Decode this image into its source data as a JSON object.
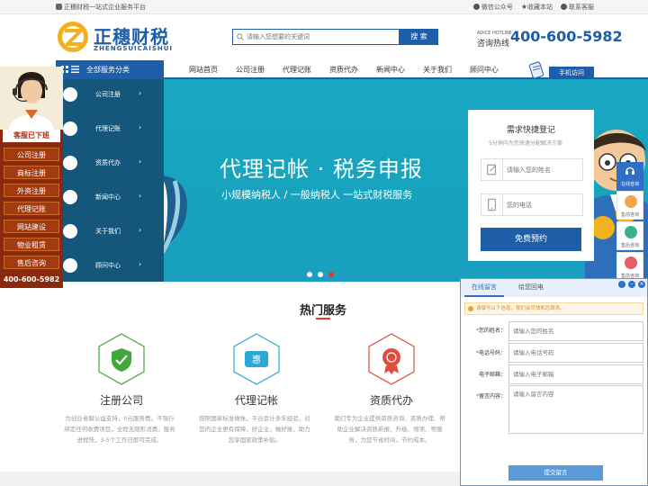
{
  "topbar": {
    "slogan": "正穗财税一站式企业服务平台",
    "links": [
      "微信公众号",
      "收藏本站",
      "联系客服"
    ]
  },
  "header": {
    "logo_cn": "正穗财税",
    "logo_en": "ZHENGSUICAISHUI",
    "search_placeholder": "请输入您想要的关键词",
    "search_button": "搜 索",
    "hotline_en": "ADICE HOTLINE",
    "hotline_cn": "咨询热线",
    "hotline_number": "400-600-5982"
  },
  "nav": {
    "category_label": "全部服务分类",
    "items": [
      "网站首页",
      "公司注册",
      "代理记账",
      "资质代办",
      "新闻中心",
      "关于我们",
      "顾问中心"
    ],
    "mobile_label": "手机访问"
  },
  "category_menu": {
    "items": [
      {
        "label": "公司注册",
        "arrow": "›"
      },
      {
        "label": "代理记账",
        "arrow": "›"
      },
      {
        "label": "资质代办",
        "arrow": "›"
      },
      {
        "label": "新闻中心",
        "arrow": "›"
      },
      {
        "label": "关于我们",
        "arrow": "›"
      },
      {
        "label": "顾问中心",
        "arrow": "›"
      }
    ]
  },
  "banner": {
    "title": "代理记帐 · 税务申报",
    "subtitle": "小规模纳税人 / 一般纳税人   一站式财税服务",
    "slide_count": 3,
    "active_slide": 3
  },
  "quick_register": {
    "heading": "需求快捷登记",
    "subheading": "5分钟内为您快速分配解决方案",
    "name_placeholder": "请输入您的姓名",
    "phone_placeholder": "您的电话",
    "submit": "免费预约"
  },
  "left_ad": {
    "status": "客服已下班",
    "items": [
      "公司注册",
      "商标注册",
      "外资注册",
      "代理记账",
      "网站建设",
      "物业租赁",
      "售后咨询"
    ],
    "phone": "400-600-5982"
  },
  "hot_services": {
    "title": "热门服务",
    "cards": [
      {
        "title": "注册公司",
        "desc": "为创业者解公益支持，0元服务费。不强行绑定任何收费项目，全程无隐形消费。服务进程快，3-5个工作日即可完成。",
        "icon": "shield-check-icon",
        "color": "#41a83a"
      },
      {
        "title": "代理记帐",
        "desc": "按照国家标准做账，平台会计多年经验，对您的企业更有保障，好企业，做好账，助力您享国家政策补贴。",
        "icon": "hui-ticket-icon",
        "color": "#2aa9d8"
      },
      {
        "title": "资质代办",
        "desc": "我们专为企业提供资质咨询、资质办理、帮助企业解决资质新报、升级、增项、等服务，为您节省时间，节约成本。",
        "icon": "medal-icon",
        "color": "#e04b3c"
      }
    ]
  },
  "right_bar": {
    "head": "在线咨询",
    "items": [
      "售前咨询",
      "售后咨询",
      "售前咨询"
    ]
  },
  "message_panel": {
    "tabs": [
      "在线留言",
      "给您回电"
    ],
    "notice": "请填写以下信息，我们会尽快和您联系。",
    "fields": [
      {
        "label": "您的姓名：",
        "required": "*",
        "placeholder": "请输入您的姓名"
      },
      {
        "label": "电话号码：",
        "required": "*",
        "placeholder": "请输入电话号码"
      },
      {
        "label": "电子邮箱：",
        "required": "",
        "placeholder": "请输入电子邮箱"
      }
    ],
    "message_label": "留言内容：",
    "message_required": "*",
    "message_placeholder": "请输入留言内容",
    "submit": "提交留言"
  },
  "colors": {
    "brand_blue": "#1e5ea8",
    "banner_teal": "#17a5c1",
    "menu_dark": "#15577a",
    "ad_red": "#8a2a0d",
    "accent_red": "#e03c2b"
  }
}
